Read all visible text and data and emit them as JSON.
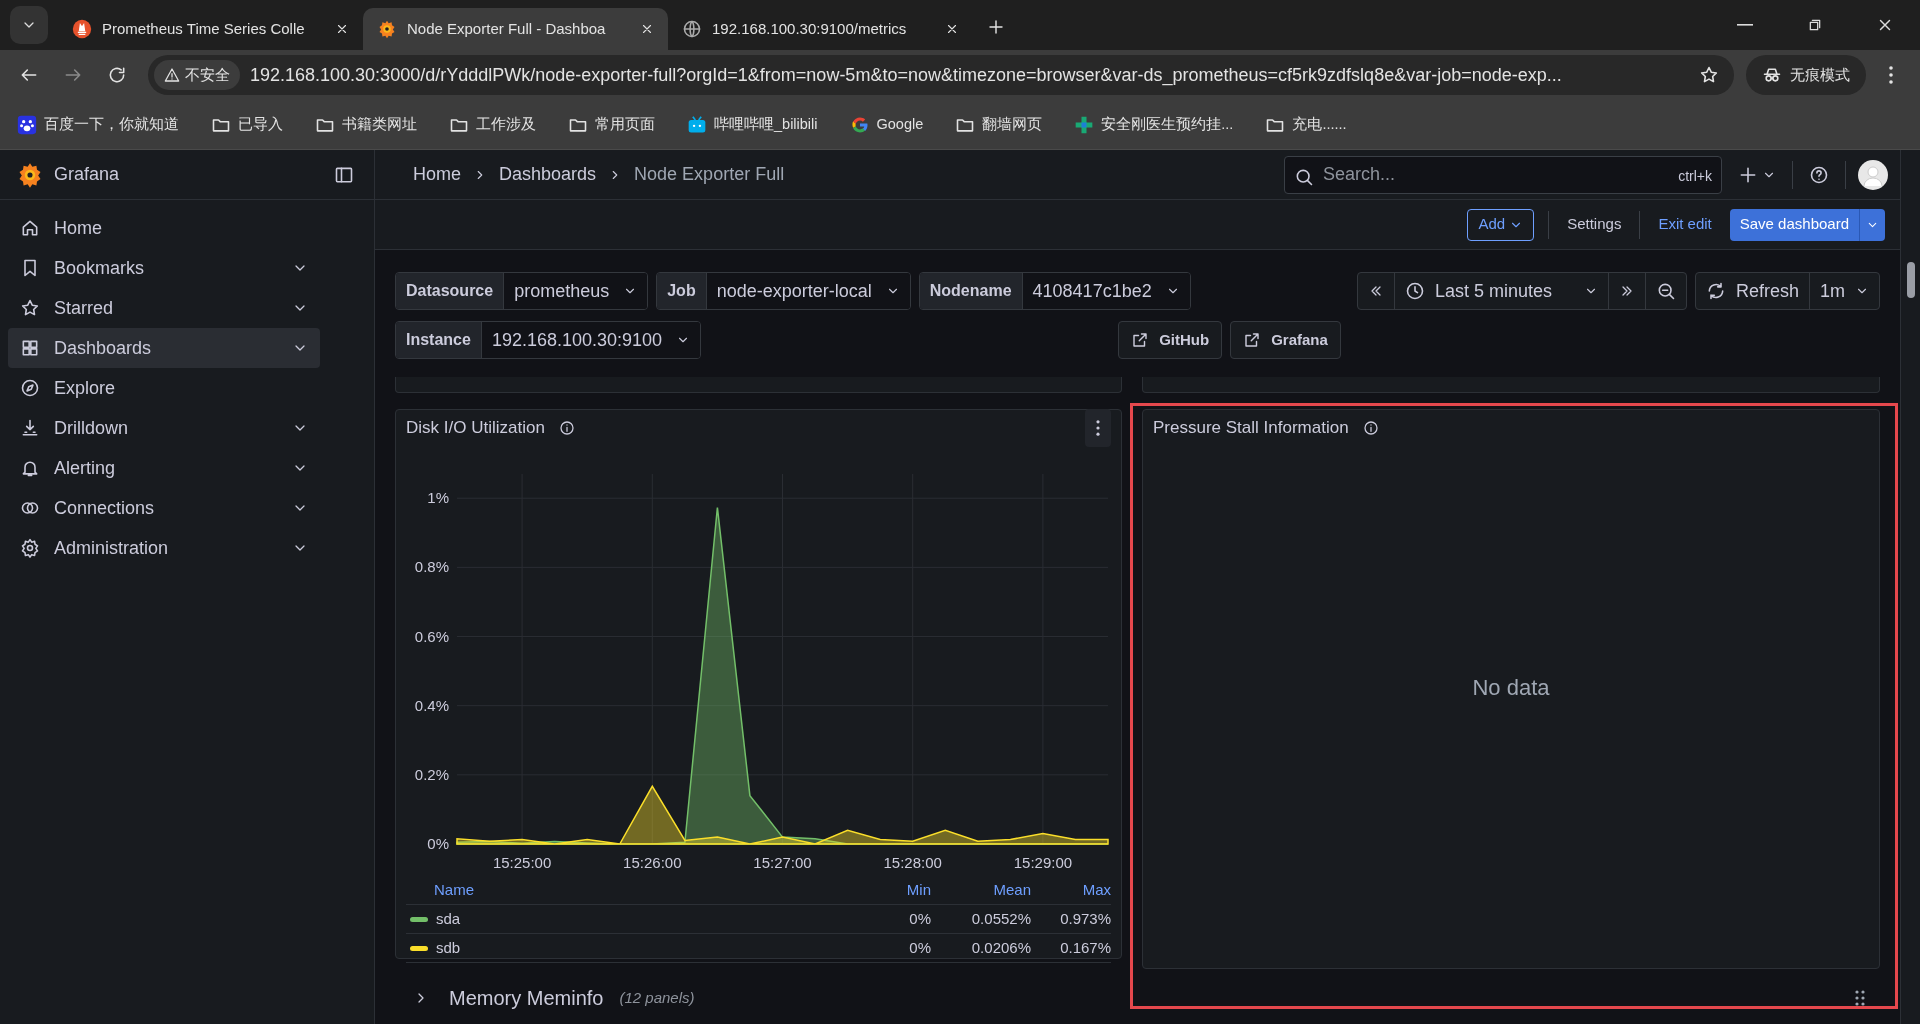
{
  "browser": {
    "tabs": [
      {
        "title": "Prometheus Time Series Colle",
        "selected": false
      },
      {
        "title": "Node Exporter Full - Dashboa",
        "selected": true
      },
      {
        "title": "192.168.100.30:9100/metrics",
        "selected": false
      }
    ],
    "security": "不安全",
    "url": "192.168.100.30:3000/d/rYdddlPWk/node-exporter-full?orgId=1&from=now-5m&to=now&timezone=browser&var-ds_prometheus=cf5rk9zdfslq8e&var-job=node-exp...",
    "incognito": "无痕模式",
    "bookmarks": [
      {
        "label": "百度一下，你就知道",
        "kind": "site"
      },
      {
        "label": "已导入",
        "kind": "folder"
      },
      {
        "label": "书籍类网址",
        "kind": "folder"
      },
      {
        "label": "工作涉及",
        "kind": "folder"
      },
      {
        "label": "常用页面",
        "kind": "folder"
      },
      {
        "label": "哔哩哔哩_bilibili",
        "kind": "site"
      },
      {
        "label": "Google",
        "kind": "site"
      },
      {
        "label": "翻墙网页",
        "kind": "folder"
      },
      {
        "label": "安全刚医生预约挂...",
        "kind": "site"
      },
      {
        "label": "充电......",
        "kind": "folder"
      }
    ]
  },
  "app": {
    "name": "Grafana"
  },
  "sidebar": {
    "items": [
      {
        "label": "Home",
        "expandable": false,
        "selected": false
      },
      {
        "label": "Bookmarks",
        "expandable": true,
        "selected": false
      },
      {
        "label": "Starred",
        "expandable": true,
        "selected": false
      },
      {
        "label": "Dashboards",
        "expandable": true,
        "selected": true
      },
      {
        "label": "Explore",
        "expandable": false,
        "selected": false
      },
      {
        "label": "Drilldown",
        "expandable": true,
        "selected": false
      },
      {
        "label": "Alerting",
        "expandable": true,
        "selected": false
      },
      {
        "label": "Connections",
        "expandable": true,
        "selected": false
      },
      {
        "label": "Administration",
        "expandable": true,
        "selected": false
      }
    ]
  },
  "breadcrumbs": [
    "Home",
    "Dashboards",
    "Node Exporter Full"
  ],
  "search": {
    "placeholder": "Search...",
    "shortcut": "ctrl+k"
  },
  "toolbar": {
    "add": "Add",
    "settings": "Settings",
    "exit_edit": "Exit edit",
    "save": "Save dashboard"
  },
  "variables": [
    {
      "label": "Datasource",
      "value": "prometheus"
    },
    {
      "label": "Job",
      "value": "node-exporter-local"
    },
    {
      "label": "Nodename",
      "value": "4108417c1be2"
    },
    {
      "label": "Instance",
      "value": "192.168.100.30:9100"
    }
  ],
  "time_range": "Last 5 minutes",
  "refresh": "Refresh",
  "refresh_interval": "1m",
  "links": [
    "GitHub",
    "Grafana"
  ],
  "panels": [
    {
      "kind": "timeseries",
      "title": "Disk I/O Utilization",
      "chart_data": {
        "type": "area",
        "categories": [
          null,
          null,
          "15:25:00",
          null,
          null,
          null,
          "15:26:00",
          null,
          null,
          null,
          "15:27:00",
          null,
          null,
          null,
          "15:28:00",
          null,
          null,
          null,
          "15:29:00",
          null,
          null
        ],
        "ylim": [
          0,
          1.07
        ],
        "grid": true,
        "yticks": [
          {
            "value": 0,
            "label": "0%"
          },
          {
            "value": 0.2,
            "label": "0.2%"
          },
          {
            "value": 0.4,
            "label": "0.4%"
          },
          {
            "value": 0.6,
            "label": "0.6%"
          },
          {
            "value": 0.8,
            "label": "0.8%"
          },
          {
            "value": 1,
            "label": "1%"
          }
        ],
        "series": [
          {
            "name": "sda",
            "color": "#73bf69",
            "values": [
              0.005,
              0.007,
              0.002,
              0.007,
              0.003,
              0,
              0,
              0.005,
              0.973,
              0.14,
              0.02,
              0.015,
              0,
              0,
              0,
              0,
              0,
              0,
              0,
              0,
              0
            ]
          },
          {
            "name": "sdb",
            "color": "#fade2a",
            "values": [
              0.015,
              0.008,
              0.013,
              0,
              0.013,
              0,
              0.167,
              0.01,
              0.02,
              0,
              0.02,
              0,
              0.04,
              0.013,
              0.008,
              0.04,
              0.008,
              0.013,
              0.03,
              0.013,
              0.013
            ]
          }
        ]
      },
      "legend": {
        "columns": [
          "Name",
          "Min",
          "Mean",
          "Max"
        ],
        "rows": [
          {
            "min": "0%",
            "mean": "0.0552%",
            "max": "0.973%"
          },
          {
            "min": "0%",
            "mean": "0.0206%",
            "max": "0.167%"
          }
        ]
      }
    },
    {
      "kind": "nodata",
      "title": "Pressure Stall Information",
      "message": "No data",
      "highlighted": true
    }
  ],
  "row": {
    "title": "Memory Meminfo",
    "count": "(12 panels)",
    "expanded": false
  }
}
